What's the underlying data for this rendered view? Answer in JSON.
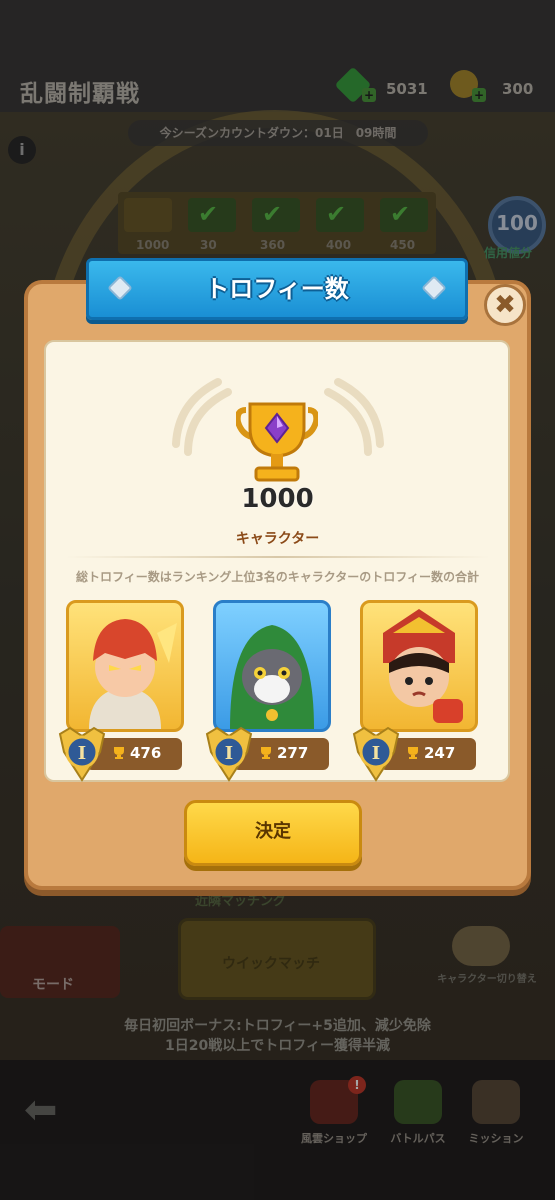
{
  "header": {
    "title": "乱闘制覇戦",
    "gem_count": "5031",
    "ticket_count": "300"
  },
  "season": {
    "countdown": "今シーズンカウントダウン：01日　09時間"
  },
  "track": {
    "milestones": [
      "1000",
      "30",
      "360",
      "400",
      "450"
    ]
  },
  "badge": {
    "value": "100",
    "label": "信用値分"
  },
  "modal": {
    "title": "トロフィー数",
    "total_trophies": "1000",
    "section_label": "キャラクター",
    "description": "総トロフィー数はランキング上位3名のキャラクターのトロフィー数の合計",
    "characters": [
      {
        "trophies": "476",
        "rank": "I",
        "frame": "gold"
      },
      {
        "trophies": "277",
        "rank": "I",
        "frame": "blue"
      },
      {
        "trophies": "247",
        "rank": "I",
        "frame": "gold"
      }
    ],
    "confirm_label": "決定"
  },
  "lobby": {
    "matching_label": "近隣マッチング",
    "mode_label": "モード",
    "quick_match_label": "ウイックマッチ",
    "char_switch_label": "キャラクター切り替え",
    "bonus_line1": "毎日初回ボーナス:トロフィー+5追加、減少免除",
    "bonus_line2": "1日20戦以上でトロフィー獲得半減"
  },
  "nav": {
    "items": [
      {
        "label": "風雲ショップ",
        "badge": "!"
      },
      {
        "label": "バトルパス",
        "badge": ""
      },
      {
        "label": "ミッション",
        "badge": ""
      }
    ]
  },
  "colors": {
    "banner_blue": "#1a8fd4",
    "panel_tan": "#e0a86b",
    "confirm_yellow": "#f5b517",
    "label_brown": "#8b4a18"
  }
}
